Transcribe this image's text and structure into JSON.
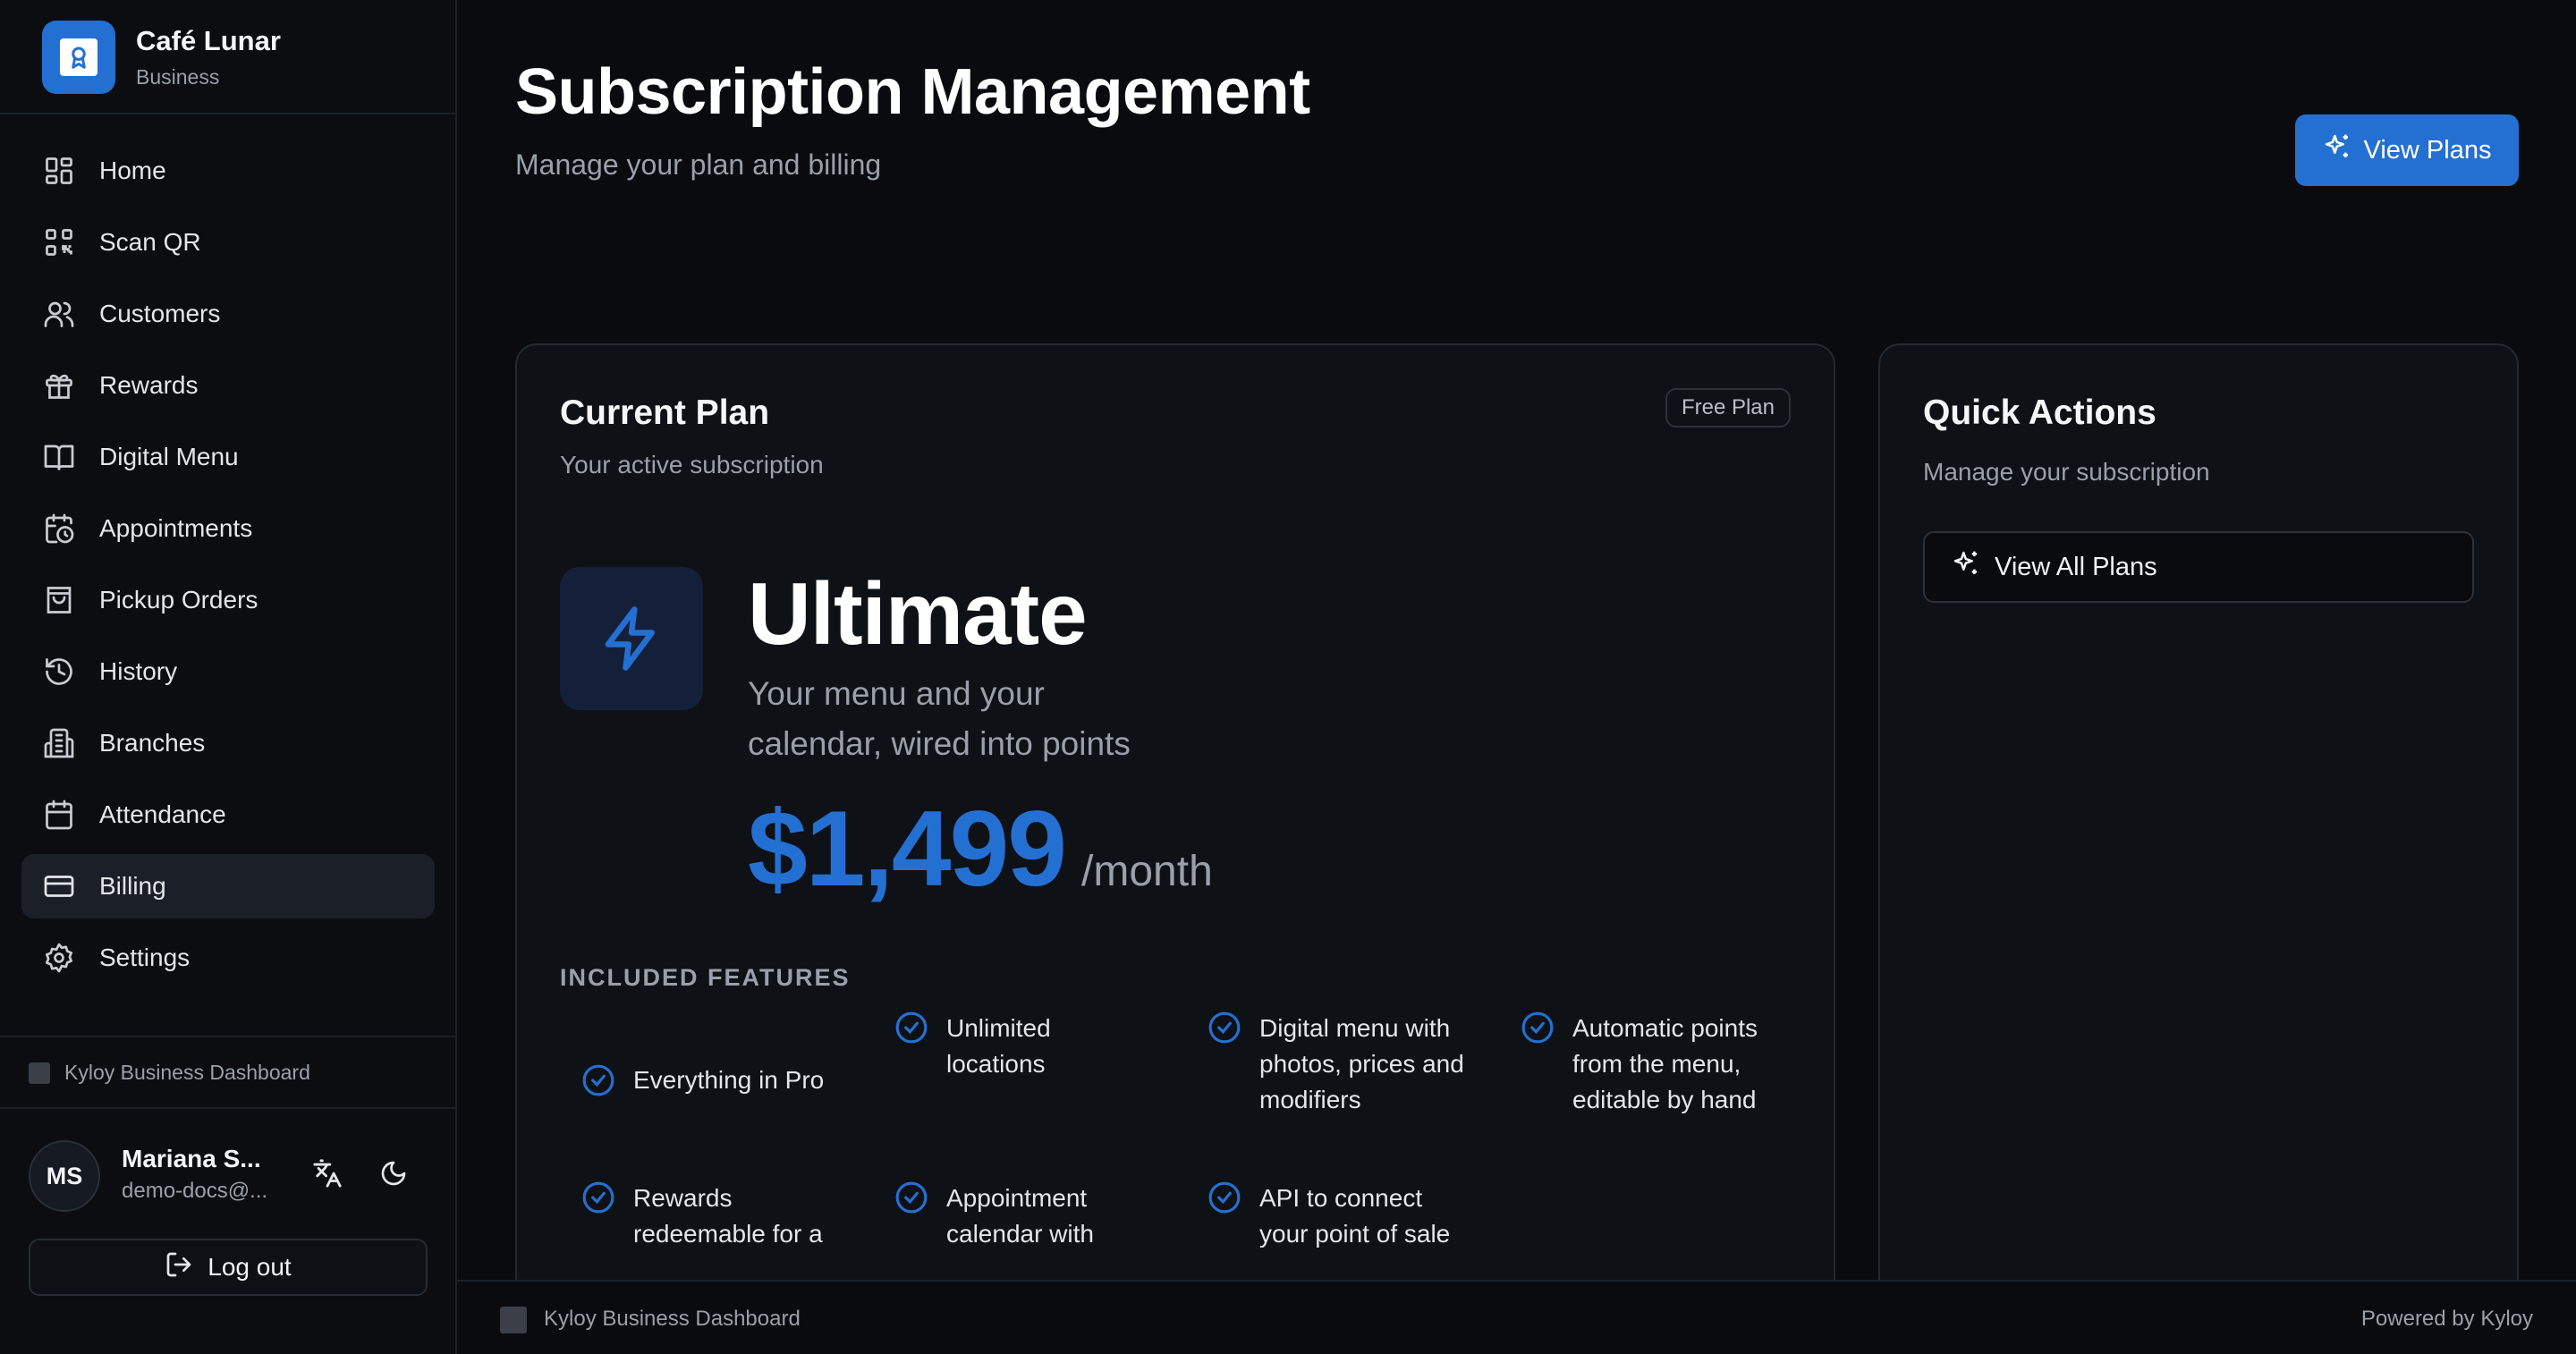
{
  "brand": {
    "name": "Café Lunar",
    "subtitle": "Business"
  },
  "nav": [
    {
      "label": "Home",
      "icon": "grid-icon"
    },
    {
      "label": "Scan QR",
      "icon": "qr-code-icon"
    },
    {
      "label": "Customers",
      "icon": "users-icon"
    },
    {
      "label": "Rewards",
      "icon": "gift-icon"
    },
    {
      "label": "Digital Menu",
      "icon": "book-open-icon"
    },
    {
      "label": "Appointments",
      "icon": "calendar-clock-icon"
    },
    {
      "label": "Pickup Orders",
      "icon": "shopping-bag-icon"
    },
    {
      "label": "History",
      "icon": "history-icon"
    },
    {
      "label": "Branches",
      "icon": "building-icon"
    },
    {
      "label": "Attendance",
      "icon": "calendar-icon"
    },
    {
      "label": "Billing",
      "icon": "credit-card-icon",
      "active": true
    },
    {
      "label": "Settings",
      "icon": "gear-icon"
    }
  ],
  "sidebar_footer": "Kyloy Business Dashboard",
  "user": {
    "initials": "MS",
    "name": "Mariana S...",
    "email": "demo-docs@...",
    "logout_label": "Log out"
  },
  "header": {
    "title": "Subscription Management",
    "subtitle": "Manage your plan and billing",
    "view_plans_label": "View Plans"
  },
  "current_plan": {
    "title": "Current Plan",
    "description": "Your active subscription",
    "badge": "Free Plan",
    "plan_name": "Ultimate",
    "plan_description": "Your menu and your calendar, wired into points",
    "price": "$1,499",
    "period": "/month",
    "features_heading": "INCLUDED FEATURES",
    "features": [
      "Everything in Pro",
      "Unlimited locations",
      "Digital menu with photos, prices and modifiers",
      "Automatic points from the menu, editable by hand",
      "Rewards redeemable for a",
      "Appointment calendar with",
      "API to connect your point of sale"
    ]
  },
  "quick_actions": {
    "title": "Quick Actions",
    "description": "Manage your subscription",
    "view_all_label": "View All Plans"
  },
  "footer": {
    "left": "Kyloy Business Dashboard",
    "right": "Powered by Kyloy"
  },
  "colors": {
    "accent": "#2470d2",
    "background": "#090b0f",
    "card": "#0e1116"
  }
}
